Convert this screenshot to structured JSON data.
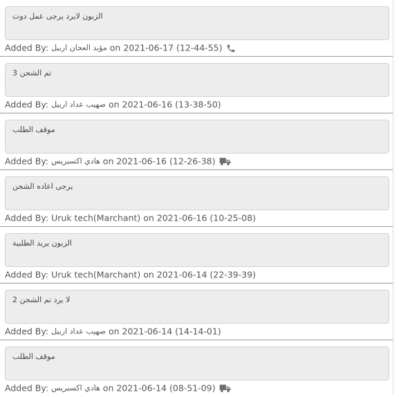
{
  "labels": {
    "added_by": "Added By:",
    "on": "on"
  },
  "comments": [
    {
      "text": "الزبون لايرد يرجى عمل دوت",
      "author": "مؤيد العجان اربيل",
      "date": "2021-06-17",
      "time": "(12-44-55)",
      "icon": "phone-icon"
    },
    {
      "text": "تم الشحن 3",
      "author": "صهيب عداد اربيل",
      "date": "2021-06-16",
      "time": "(13-38-50)",
      "icon": ""
    },
    {
      "text": "موقف الطلب",
      "author": "هادي اكسبريس",
      "date": "2021-06-16",
      "time": "(12-26-38)",
      "icon": "truck-icon"
    },
    {
      "text": "يرجى اعاده الشحن",
      "author": "Uruk tech(Marchant)",
      "date": "2021-06-16",
      "time": "(10-25-08)",
      "icon": ""
    },
    {
      "text": "الزبون يريد الطلبية",
      "author": "Uruk tech(Marchant)",
      "date": "2021-06-14",
      "time": "(22-39-39)",
      "icon": ""
    },
    {
      "text": "لا يرد تم الشحن 2",
      "author": "صهيب عداد اربيل",
      "date": "2021-06-14",
      "time": "(14-14-01)",
      "icon": ""
    },
    {
      "text": "موقف الطلب",
      "author": "هادي اكسبريس",
      "date": "2021-06-14",
      "time": "(08-51-09)",
      "icon": "truck-icon"
    }
  ],
  "colors": {
    "note_bg": "#ededed",
    "meta_text": "#555555",
    "divider": "#9a9a9a",
    "icon": "#6d6d6d"
  }
}
